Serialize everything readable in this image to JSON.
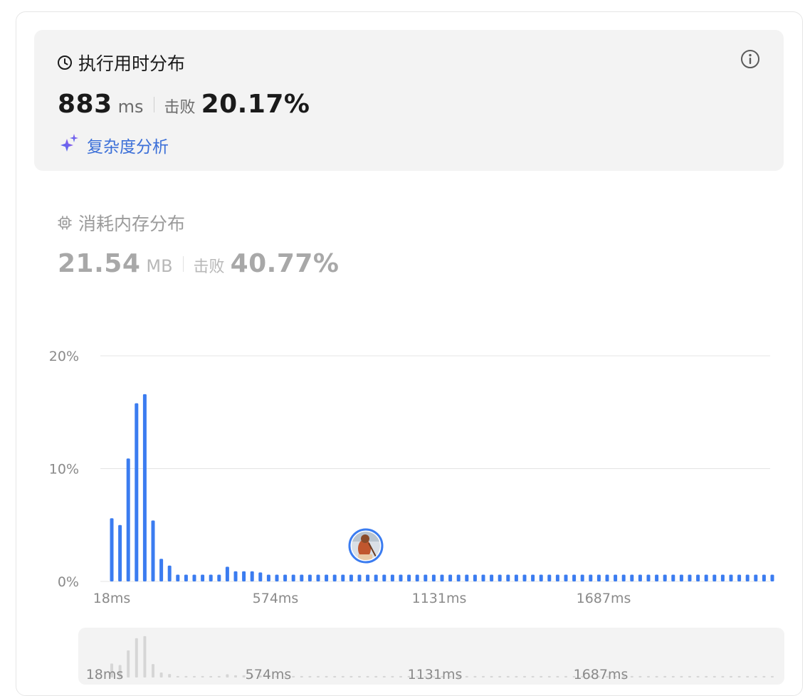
{
  "runtime": {
    "title": "执行用时分布",
    "value": "883",
    "unit": "ms",
    "beat_label": "击败",
    "beat_pct": "20.17%",
    "complexity_label": "复杂度分析"
  },
  "memory": {
    "title": "消耗内存分布",
    "value": "21.54",
    "unit": "MB",
    "beat_label": "击败",
    "beat_pct": "40.77%"
  },
  "colors": {
    "bar": "#3b7cf0",
    "overview_bar": "#d6d6d6",
    "accent_link": "#3b6fd8",
    "gradient_icon": [
      "#3d6ff2",
      "#a257e8"
    ]
  },
  "icons": {
    "runtime": "clock-icon",
    "memory": "chip-icon",
    "info": "info-icon",
    "complexity": "sparkle-icon",
    "marker": "avatar-marker"
  },
  "chart_data": {
    "type": "bar",
    "title": "",
    "xlabel": "",
    "ylabel": "",
    "x_tick_labels": [
      "18ms",
      "574ms",
      "1131ms",
      "1687ms"
    ],
    "y_tick_labels": [
      "20%",
      "10%",
      "0%"
    ],
    "ylim": [
      0,
      20
    ],
    "grid": true,
    "values": [
      5.6,
      5.0,
      10.9,
      15.8,
      16.6,
      5.4,
      2.0,
      1.4,
      0.6,
      0.6,
      0.6,
      0.6,
      0.6,
      0.6,
      1.3,
      0.9,
      0.9,
      0.9,
      0.8,
      0.6,
      0.6,
      0.6,
      0.6,
      0.6,
      0.6,
      0.6,
      0.6,
      0.6,
      0.6,
      0.6,
      0.6,
      0.6,
      0.6,
      0.6,
      0.6,
      0.6,
      0.6,
      0.6,
      0.6,
      0.6,
      0.6,
      0.6,
      0.6,
      0.6,
      0.6,
      0.6,
      0.6,
      0.6,
      0.6,
      0.6,
      0.6,
      0.6,
      0.6,
      0.6,
      0.6,
      0.6,
      0.6,
      0.6,
      0.6,
      0.6,
      0.6,
      0.6,
      0.6,
      0.6,
      0.6,
      0.6,
      0.6,
      0.6,
      0.6,
      0.6,
      0.6,
      0.6,
      0.6,
      0.6,
      0.6,
      0.6,
      0.6,
      0.6,
      0.6,
      0.6,
      0.6
    ],
    "marker_bar_index": 32
  },
  "overview": {
    "x_tick_labels": [
      "18ms",
      "574ms",
      "1131ms",
      "1687ms"
    ]
  }
}
